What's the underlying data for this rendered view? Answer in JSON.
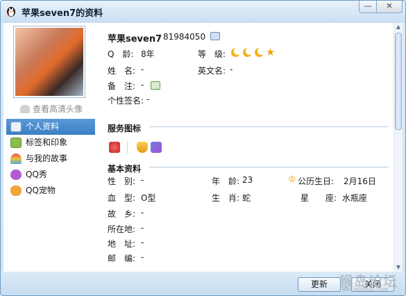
{
  "window": {
    "title": "苹果seven7的资料",
    "minimize_icon": "minimize-icon",
    "close_icon": "close-icon"
  },
  "sidebar": {
    "hd_link": "查看高清头像",
    "items": [
      {
        "label": "个人资料",
        "icon": "profile-card-icon",
        "active": true
      },
      {
        "label": "标签和印象",
        "icon": "tag-icon",
        "active": false
      },
      {
        "label": "与我的故事",
        "icon": "rainbow-icon",
        "active": false
      },
      {
        "label": "QQ秀",
        "icon": "qqshow-icon",
        "active": false
      },
      {
        "label": "QQ宠物",
        "icon": "pet-icon",
        "active": false
      }
    ]
  },
  "profile": {
    "nickname": "苹果seven7",
    "qq_number": "81984050",
    "q_age_label": "Q　龄:",
    "q_age_value": "8年",
    "level_label": "等　级:",
    "name_label": "姓　名:",
    "name_value": "-",
    "english_name_label": "英文名:",
    "english_name_value": "-",
    "remark_label": "备　注:",
    "remark_value": "-",
    "signature_label": "个性签名:",
    "signature_value": "-"
  },
  "service_icons": {
    "title": "服务图标"
  },
  "basic": {
    "title": "基本资料",
    "gender_label": "性　别:",
    "gender_value": "-",
    "age_label": "年　龄:",
    "age_value": "23",
    "birthday_label": "公历生日:",
    "birthday_value": "2月16日",
    "blood_label": "血　型:",
    "blood_value": "O型",
    "zodiac_label": "生　肖:",
    "zodiac_value": "蛇",
    "constellation_label": "星　　座:",
    "constellation_value": "水瓶座",
    "hometown_label": "故　乡:",
    "hometown_value": "-",
    "location_label": "所在地:",
    "location_value": "-",
    "address_label": "地　址:",
    "address_value": "-",
    "postcode_label": "邮　编:",
    "postcode_value": "-"
  },
  "footer": {
    "refresh_label": "更新",
    "close_label": "关闭"
  },
  "watermark": {
    "text": "猴岛论坛",
    "sub": "BBS.HOUDAO.COM"
  },
  "colors": {
    "accent": "#3b7ec4",
    "frame": "#6c9ac4"
  }
}
